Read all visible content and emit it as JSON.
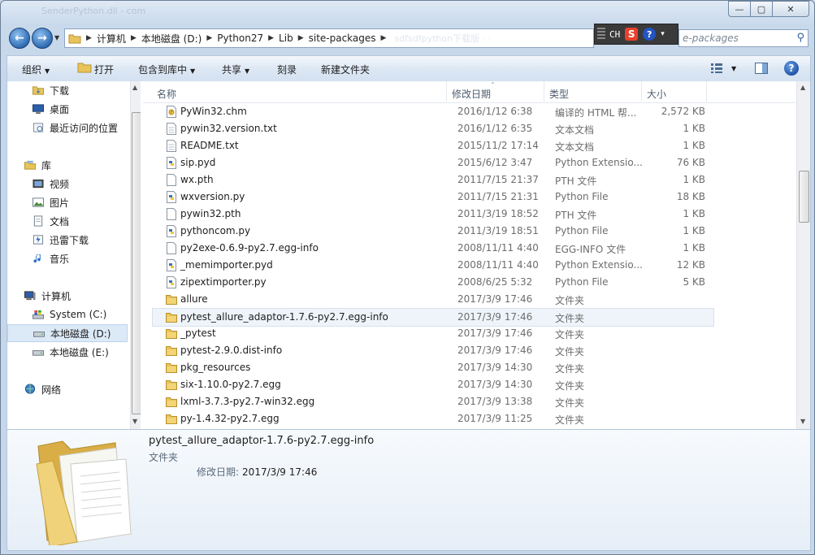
{
  "window": {
    "blurred_title": "SenderPython.dll - com",
    "controls": {
      "minimize": "—",
      "maximize": "▢",
      "close": "✕"
    }
  },
  "nav": {
    "back_icon": "arrow-left-icon",
    "forward_icon": "arrow-right-icon",
    "breadcrumb": [
      "计算机",
      "本地磁盘 (D:)",
      "Python27",
      "Lib",
      "site-packages"
    ],
    "blurred_tail": "sdfsdfpython下载版 ·  ·"
  },
  "ime": {
    "label": "CH",
    "logo": "S",
    "help": "?"
  },
  "search": {
    "placeholder": "e-packages"
  },
  "toolbar": {
    "organize": "组织",
    "open": "打开",
    "include_library": "包含到库中",
    "share": "共享",
    "burn": "刻录",
    "new_folder": "新建文件夹",
    "help": "?"
  },
  "sidebar": {
    "items": [
      {
        "label": "下载",
        "icon": "download-folder-icon"
      },
      {
        "label": "桌面",
        "icon": "desktop-icon"
      },
      {
        "label": "最近访问的位置",
        "icon": "recent-places-icon"
      },
      {
        "label": "库",
        "icon": "libraries-icon"
      },
      {
        "label": "视频",
        "icon": "videos-icon"
      },
      {
        "label": "图片",
        "icon": "pictures-icon"
      },
      {
        "label": "文档",
        "icon": "documents-icon"
      },
      {
        "label": "迅雷下载",
        "icon": "thunder-download-icon"
      },
      {
        "label": "音乐",
        "icon": "music-icon"
      },
      {
        "label": "计算机",
        "icon": "computer-icon"
      },
      {
        "label": "System (C:)",
        "icon": "system-drive-icon"
      },
      {
        "label": "本地磁盘 (D:)",
        "icon": "drive-icon"
      },
      {
        "label": "本地磁盘 (E:)",
        "icon": "drive-icon"
      },
      {
        "label": "网络",
        "icon": "network-icon"
      }
    ]
  },
  "columns": {
    "name": "名称",
    "date": "修改日期",
    "type": "类型",
    "size": "大小"
  },
  "files": [
    {
      "name": "PyWin32.chm",
      "date": "2016/1/12 6:38",
      "type": "编译的 HTML 帮...",
      "size": "2,572 KB",
      "icon": "chm-file-icon"
    },
    {
      "name": "pywin32.version.txt",
      "date": "2016/1/12 6:35",
      "type": "文本文档",
      "size": "1 KB",
      "icon": "text-file-icon"
    },
    {
      "name": "README.txt",
      "date": "2015/11/2 17:14",
      "type": "文本文档",
      "size": "1 KB",
      "icon": "text-file-icon"
    },
    {
      "name": "sip.pyd",
      "date": "2015/6/12 3:47",
      "type": "Python Extensio...",
      "size": "76 KB",
      "icon": "python-file-icon"
    },
    {
      "name": "wx.pth",
      "date": "2011/7/15 21:37",
      "type": "PTH 文件",
      "size": "1 KB",
      "icon": "blank-file-icon"
    },
    {
      "name": "wxversion.py",
      "date": "2011/7/15 21:31",
      "type": "Python File",
      "size": "18 KB",
      "icon": "python-file-icon"
    },
    {
      "name": "pywin32.pth",
      "date": "2011/3/19 18:52",
      "type": "PTH 文件",
      "size": "1 KB",
      "icon": "blank-file-icon"
    },
    {
      "name": "pythoncom.py",
      "date": "2011/3/19 18:51",
      "type": "Python File",
      "size": "1 KB",
      "icon": "python-file-icon"
    },
    {
      "name": "py2exe-0.6.9-py2.7.egg-info",
      "date": "2008/11/11 4:40",
      "type": "EGG-INFO 文件",
      "size": "1 KB",
      "icon": "blank-file-icon"
    },
    {
      "name": "_memimporter.pyd",
      "date": "2008/11/11 4:40",
      "type": "Python Extensio...",
      "size": "12 KB",
      "icon": "python-file-icon"
    },
    {
      "name": "zipextimporter.py",
      "date": "2008/6/25 5:32",
      "type": "Python File",
      "size": "5 KB",
      "icon": "python-file-icon"
    },
    {
      "name": "allure",
      "date": "2017/3/9 17:46",
      "type": "文件夹",
      "size": "",
      "icon": "folder-icon"
    },
    {
      "name": "pytest_allure_adaptor-1.7.6-py2.7.egg-info",
      "date": "2017/3/9 17:46",
      "type": "文件夹",
      "size": "",
      "icon": "folder-icon",
      "selected": true
    },
    {
      "name": "_pytest",
      "date": "2017/3/9 17:46",
      "type": "文件夹",
      "size": "",
      "icon": "folder-icon"
    },
    {
      "name": "pytest-2.9.0.dist-info",
      "date": "2017/3/9 17:46",
      "type": "文件夹",
      "size": "",
      "icon": "folder-icon"
    },
    {
      "name": "pkg_resources",
      "date": "2017/3/9 14:30",
      "type": "文件夹",
      "size": "",
      "icon": "folder-icon"
    },
    {
      "name": "six-1.10.0-py2.7.egg",
      "date": "2017/3/9 14:30",
      "type": "文件夹",
      "size": "",
      "icon": "folder-icon"
    },
    {
      "name": "lxml-3.7.3-py2.7-win32.egg",
      "date": "2017/3/9 13:38",
      "type": "文件夹",
      "size": "",
      "icon": "folder-icon"
    },
    {
      "name": "py-1.4.32-py2.7.egg",
      "date": "2017/3/9 11:25",
      "type": "文件夹",
      "size": "",
      "icon": "folder-icon"
    }
  ],
  "details": {
    "name": "pytest_allure_adaptor-1.7.6-py2.7.egg-info",
    "type": "文件夹",
    "modified_label": "修改日期:",
    "modified_value": "2017/3/9 17:46"
  },
  "colors": {
    "folder": "#e9c45a",
    "selection": "#eef4fa",
    "chrome": "#c9d9ec"
  }
}
